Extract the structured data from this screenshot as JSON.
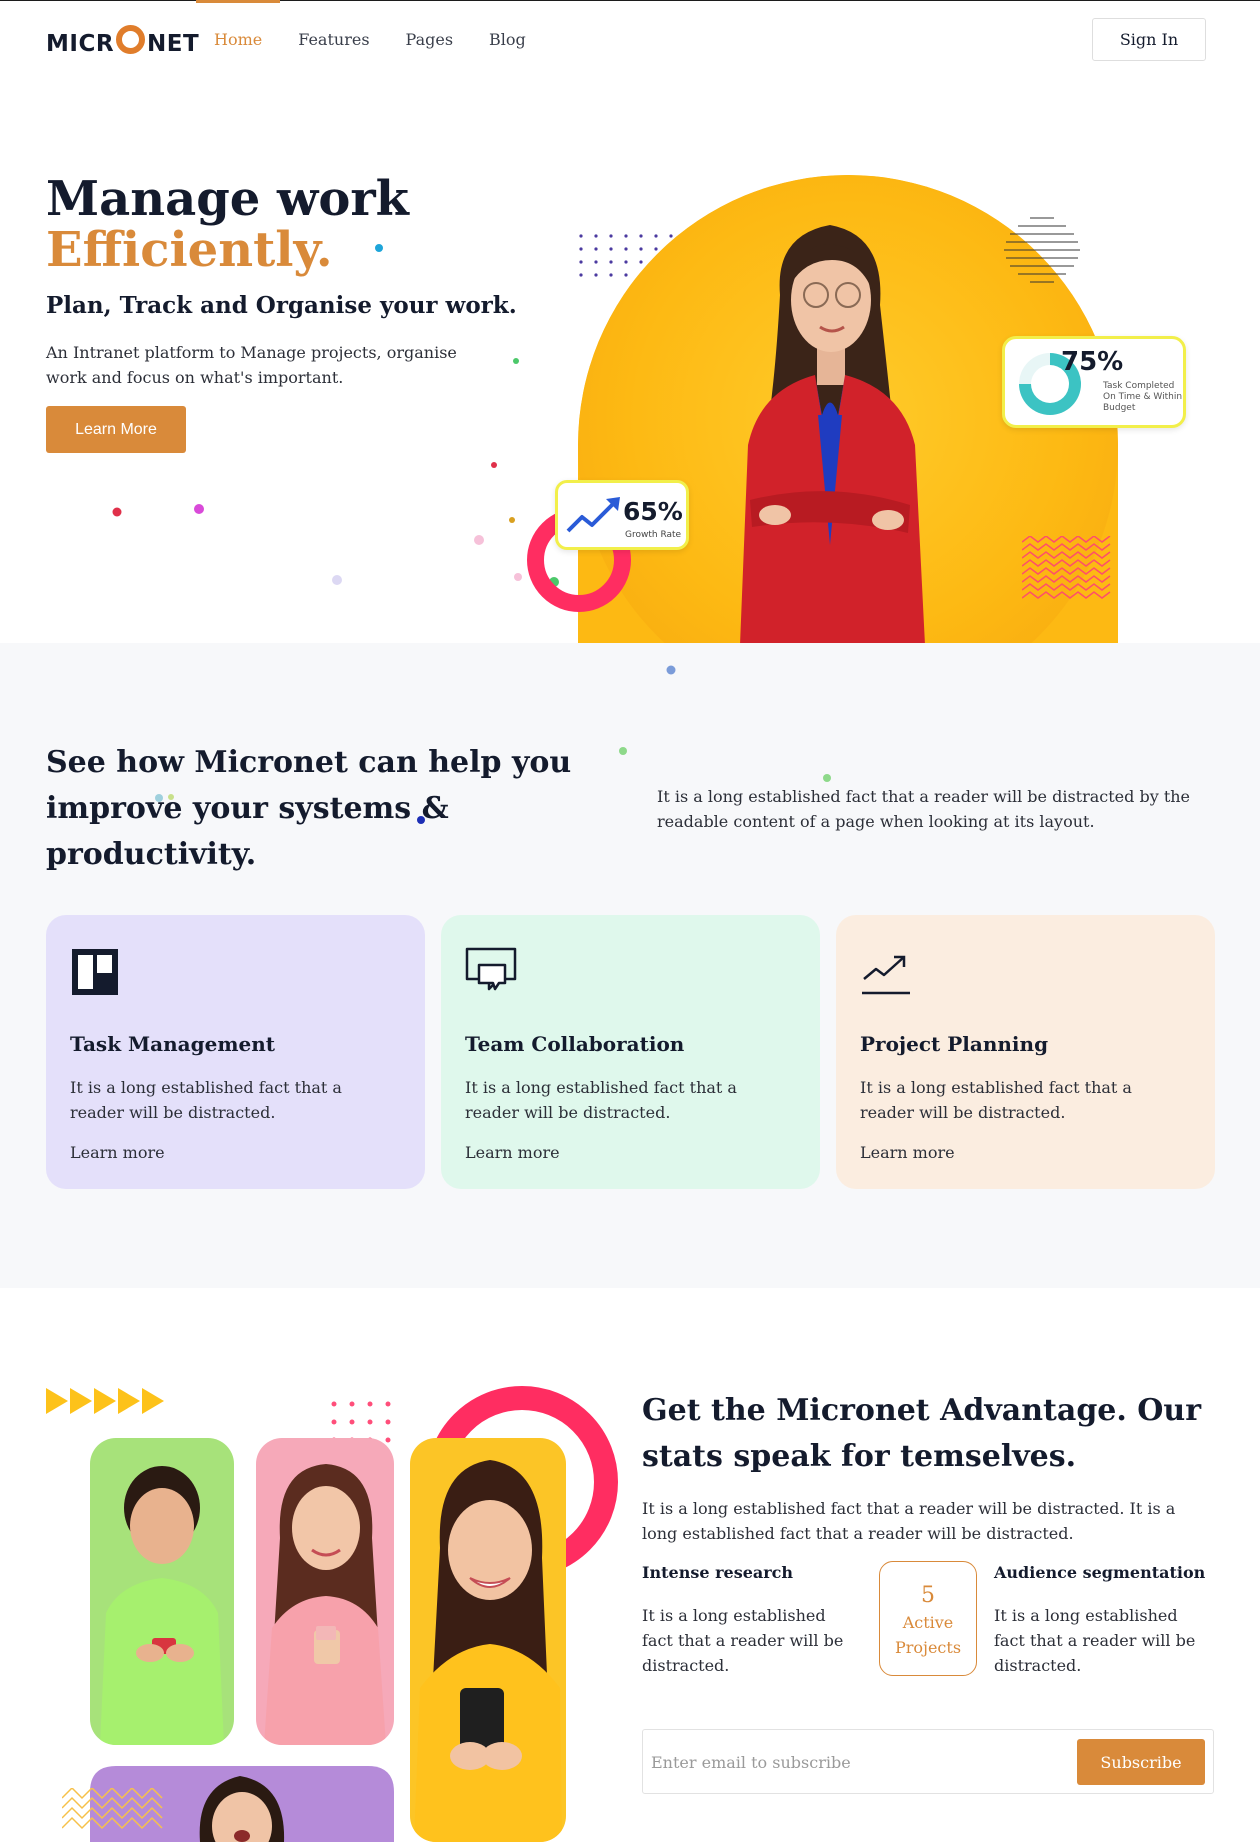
{
  "header": {
    "logo_prefix": "MICR",
    "logo_suffix": "NET",
    "nav": [
      {
        "label": "Home",
        "active": true
      },
      {
        "label": "Features",
        "active": false
      },
      {
        "label": "Pages",
        "active": false
      },
      {
        "label": "Blog",
        "active": false
      }
    ],
    "signin_label": "Sign In"
  },
  "hero": {
    "title_line1": "Manage work",
    "title_line2": "Efficiently.",
    "subtitle": "Plan, Track and Organise your work.",
    "description": "An Intranet platform to Manage projects, organise work and focus on what's important.",
    "cta_label": "Learn More",
    "stat_completed": {
      "value": "75%",
      "caption": "Task Completed On Time & Within Budget",
      "fraction": 0.75
    },
    "stat_growth": {
      "value": "65%",
      "caption": "Growth Rate"
    }
  },
  "features": {
    "title": "See how Micronet can help you improve your systems & productivity.",
    "description": "It is a long established fact that a reader will be distracted by the readable content of a page when looking at its layout.",
    "cards": [
      {
        "title": "Task Management",
        "text": "It is a long established fact that a reader will be distracted.",
        "link": "Learn more",
        "icon": "board-icon",
        "bg": "#e4e0fa"
      },
      {
        "title": "Team Collaboration",
        "text": "It is a long established fact that a reader will be distracted.",
        "link": "Learn more",
        "icon": "chat-icon",
        "bg": "#dff8ec"
      },
      {
        "title": "Project Planning",
        "text": "It is a long established fact that a reader will be distracted.",
        "link": "Learn more",
        "icon": "trend-icon",
        "bg": "#fbede0"
      }
    ]
  },
  "advantage": {
    "title": "Get the Micronet Advantage. Our stats speak for temselves.",
    "description": "It is a long established fact that a reader will be distracted. It is a long established fact that a reader will be distracted.",
    "left_feature": {
      "title": "Intense research",
      "text": "It is a long established fact that a reader will be distracted."
    },
    "projects": {
      "number": "5",
      "label_line1": "Active",
      "label_line2": "Projects"
    },
    "right_feature": {
      "title": "Audience segmentation",
      "text": "It is a long established fact that a reader will be distracted."
    },
    "subscribe": {
      "placeholder": "Enter email to subscribe",
      "button_label": "Subscribe"
    }
  },
  "colors": {
    "accent": "#d98a3a",
    "yellow": "#fdb913",
    "pink": "#ff2d61",
    "dark": "#141b2d"
  }
}
